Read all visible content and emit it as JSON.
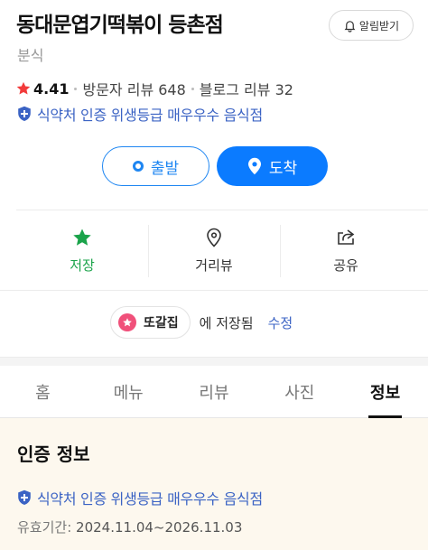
{
  "place": {
    "name": "동대문엽기떡볶이 등촌점",
    "category": "분식",
    "rating": "4.41",
    "visitor_reviews": "방문자 리뷰 648",
    "blog_reviews": "블로그 리뷰 32",
    "certification": "식약처 인증 위생등급 매우우수 음식점"
  },
  "header": {
    "notify_label": "알림받기"
  },
  "route": {
    "depart_label": "출발",
    "arrive_label": "도착"
  },
  "actions": {
    "save_label": "저장",
    "distance_label": "거리뷰",
    "share_label": "공유"
  },
  "saved": {
    "folder_name": "또갈집",
    "saved_text": "에 저장됨",
    "edit_label": "수정"
  },
  "tabs": [
    "홈",
    "메뉴",
    "리뷰",
    "사진",
    "정보"
  ],
  "active_tab": "정보",
  "info": {
    "section_title": "인증 정보",
    "certification": "식약처 인증 위생등급 매우우수 음식점",
    "validity_label": "유효기간:",
    "validity_value": "2024.11.04~2026.11.03"
  },
  "icons": {
    "rating": "star-icon",
    "certification": "shield-plus-icon",
    "notify": "bell-icon",
    "depart": "circle-dot-icon",
    "arrive": "location-pin-icon",
    "save": "star-icon",
    "distance": "map-pin-outline-icon",
    "share": "share-icon"
  },
  "colors": {
    "accent_blue": "#0b7bff",
    "link_blue": "#3b63c4",
    "saved_green": "#1aa34a",
    "rating_red": "#f23b3b",
    "folder_pink": "#f0507a",
    "info_bg": "#fdf8ee"
  }
}
